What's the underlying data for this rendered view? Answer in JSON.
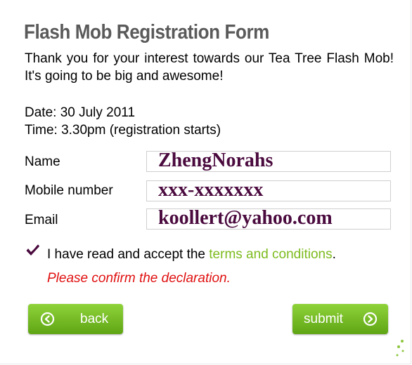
{
  "form": {
    "title": "Flash Mob Registration Form",
    "intro": "Thank you for your interest towards our Tea Tree Flash Mob! It's going to be big and awesome!",
    "date": "Date: 30 July 2011",
    "time": "Time: 3.30pm (registration starts)"
  },
  "fields": {
    "name": {
      "label": "Name",
      "value": "ZhengNorahs"
    },
    "mobile": {
      "label": "Mobile number",
      "value": "xxx-xxxxxxx"
    },
    "email": {
      "label": "Email",
      "value": "koollert@yahoo.com"
    }
  },
  "declaration": {
    "checked": true,
    "text_before": "I have read and accept the ",
    "terms_link": "terms and conditions",
    "text_after": ".",
    "error": "Please confirm the declaration."
  },
  "buttons": {
    "back_label": "back",
    "submit_label": "submit"
  },
  "colors": {
    "accent_green": "#7dbb1e",
    "button_green": "#6cb51e",
    "error_red": "#e01010",
    "handwriting": "#4a0a3e"
  },
  "icons": {
    "back": "circle-arrow-left-icon",
    "submit": "circle-arrow-right-icon",
    "checkbox": "checkmark-icon"
  }
}
